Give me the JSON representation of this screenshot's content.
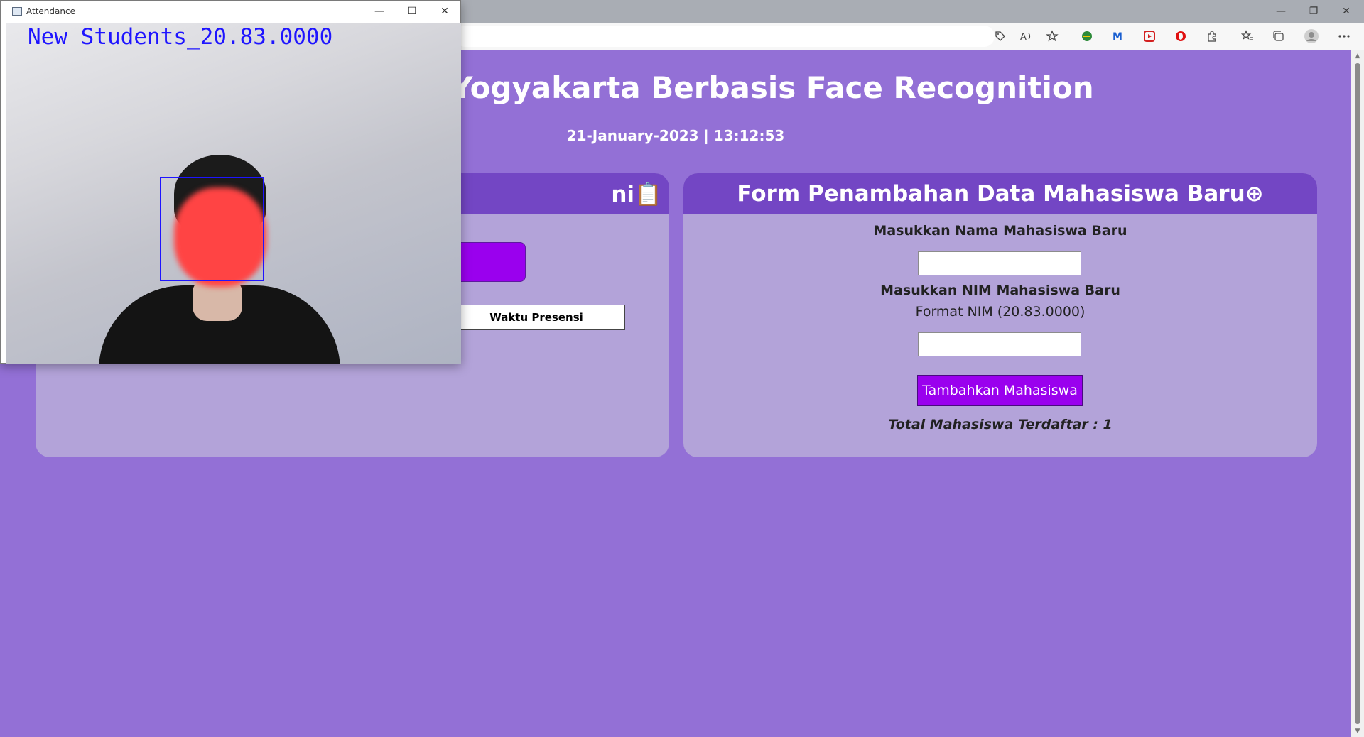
{
  "browser": {
    "window_controls": {
      "minimize": "—",
      "restore": "❐",
      "close": "✕"
    },
    "toolbar_icons": [
      "tag-icon",
      "read-aloud-icon",
      "favorite-add-icon",
      "extension-icon",
      "extension-icon",
      "extension-icon",
      "extension-icon",
      "extensions-icon",
      "favorites-icon",
      "collections-icon",
      "profile-icon",
      "more-icon"
    ]
  },
  "page": {
    "title": "as Amikom Yogyakarta Berbasis Face Recognition",
    "datetime": "21-January-2023 | 13:12:53"
  },
  "left_card": {
    "header": "ni📋",
    "table_column": "Waktu Presensi"
  },
  "right_card": {
    "header": "Form Penambahan Data Mahasiswa Baru⊕",
    "name_label": "Masukkan Nama Mahasiswa Baru",
    "name_value": "",
    "nim_label": "Masukkan NIM Mahasiswa Baru",
    "nim_format": "Format NIM (20.83.0000)",
    "nim_value": "",
    "submit_label": "Tambahkan Mahasiswa",
    "total_label": "Total Mahasiswa Terdaftar : 1"
  },
  "camera_window": {
    "title": "Attendance",
    "minimize": "—",
    "maximize": "☐",
    "close": "✕",
    "overlay_label": "New Students_20.83.0000"
  },
  "colors": {
    "page_bg": "#9370d6",
    "card_header": "#7346c4",
    "card_body": "#b3a3d9",
    "button": "#9a00ee",
    "face_box": "#1e14ff"
  }
}
